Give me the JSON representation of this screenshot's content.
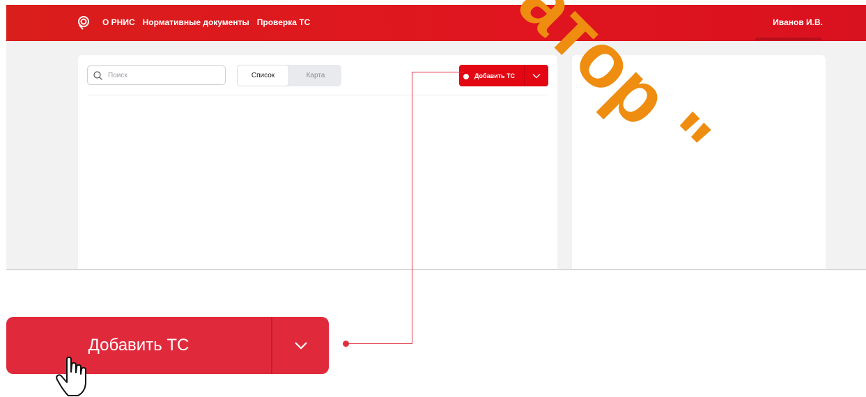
{
  "topbar": {
    "nav": [
      "О РНИС",
      "Нормативные документы",
      "Проверка ТС"
    ],
    "user": "Иванов И.В."
  },
  "search": {
    "placeholder": "Поиск"
  },
  "view_toggle": {
    "list_label": "Список",
    "map_label": "Карта",
    "selected": "Список"
  },
  "add_button": {
    "label": "Добавить ТС"
  },
  "callout": {
    "label": "Добавить ТС"
  },
  "watermark": {
    "text": "атор \""
  },
  "colors": {
    "brand_red": "#e30613",
    "callout_red": "#e02a3c",
    "watermark_orange": "#ee8d10"
  },
  "icons": [
    "logo-icon",
    "search-icon",
    "chevron-down-icon",
    "hand-cursor-icon"
  ]
}
